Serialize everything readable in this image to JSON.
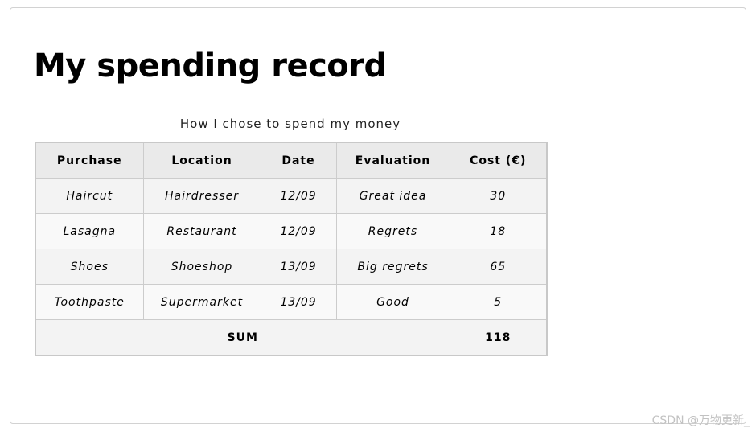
{
  "page": {
    "title": "My spending record"
  },
  "table": {
    "caption": "How I chose to spend my money",
    "headers": [
      "Purchase",
      "Location",
      "Date",
      "Evaluation",
      "Cost (€)"
    ],
    "rows": [
      [
        "Haircut",
        "Hairdresser",
        "12/09",
        "Great idea",
        "30"
      ],
      [
        "Lasagna",
        "Restaurant",
        "12/09",
        "Regrets",
        "18"
      ],
      [
        "Shoes",
        "Shoeshop",
        "13/09",
        "Big regrets",
        "65"
      ],
      [
        "Toothpaste",
        "Supermarket",
        "13/09",
        "Good",
        "5"
      ]
    ],
    "footer": {
      "label": "SUM",
      "total": "118"
    }
  },
  "watermark": "CSDN @万物更新_",
  "colors": {
    "header_bg": "#eaeaea",
    "row_odd_bg": "#f3f3f3",
    "row_even_bg": "#f9f9f9",
    "border": "#cccccc"
  }
}
